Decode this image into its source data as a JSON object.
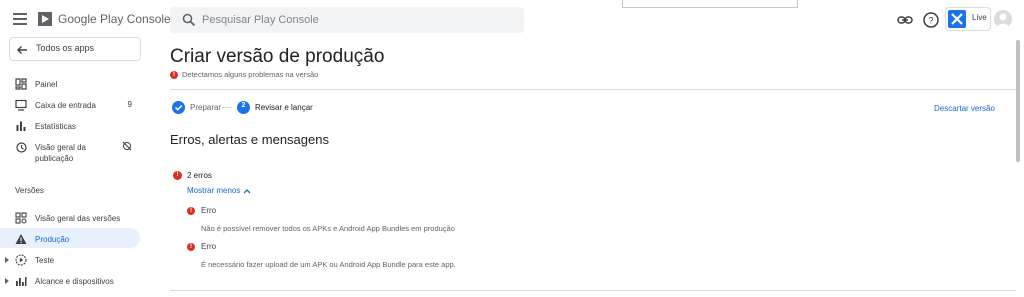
{
  "header": {
    "brand": "Google Play Console",
    "search_placeholder": "Pesquisar Play Console",
    "app_status": "Live"
  },
  "sidebar": {
    "back_label": "Todos os apps",
    "items": [
      {
        "label": "Painel",
        "icon": "dashboard-icon"
      },
      {
        "label": "Caixa de entrada",
        "count": "9",
        "icon": "inbox-icon"
      },
      {
        "label": "Estatísticas",
        "icon": "bar-chart-icon"
      },
      {
        "label_line1": "Visão geral da",
        "label_line2": "publicação",
        "icon": "history-icon",
        "trailing_icon": "sync-disabled-icon"
      }
    ],
    "section_title": "Versões",
    "release_items": [
      {
        "label": "Visão geral das versões",
        "icon": "overview-icon"
      },
      {
        "label": "Produção",
        "icon": "warning-triangle-icon",
        "active": true
      },
      {
        "label": "Teste",
        "icon": "play-circle-icon"
      },
      {
        "label": "Alcance e dispositivos",
        "icon": "chart-icon"
      }
    ]
  },
  "main": {
    "title": "Criar versão de produção",
    "warning": "Detectamos alguns problemas na versão",
    "steps": [
      {
        "label": "Preparar",
        "state": "done"
      },
      {
        "number": "2",
        "label": "Revisar e lançar",
        "state": "current"
      }
    ],
    "discard_label": "Descartar versão",
    "section_heading": "Erros, alertas e mensagens",
    "error_count": "2 erros",
    "toggle_label": "Mostrar menos",
    "errors": [
      {
        "title": "Erro",
        "message": "Não é possível remover todos os APKs e Android App Bundles em produção"
      },
      {
        "title": "Erro",
        "message": "É necessário fazer upload de um APK ou Android App Bundle para este app."
      }
    ]
  },
  "colors": {
    "accent": "#1a73e8",
    "link": "#1967d2",
    "error": "#d93025",
    "active_bg": "#e8f0fe"
  }
}
